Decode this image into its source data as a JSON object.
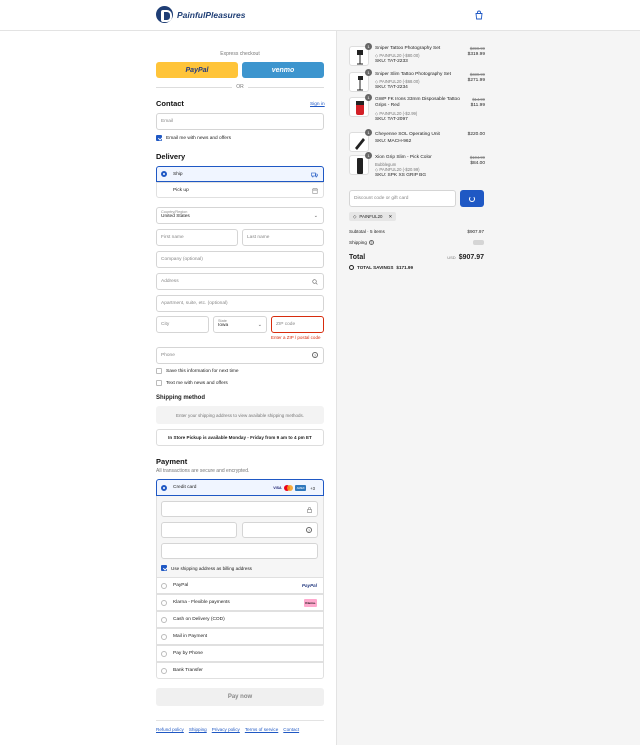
{
  "header": {
    "brand": "PainfulPleasures"
  },
  "express": {
    "title": "Express checkout",
    "paypal": "PayPal",
    "venmo": "venmo",
    "or": "OR"
  },
  "contact": {
    "title": "Contact",
    "signin": "Sign in",
    "email_placeholder": "Email",
    "email_news": "Email me with news and offers"
  },
  "delivery": {
    "title": "Delivery",
    "ship": "Ship",
    "pickup": "Pick up",
    "country_label": "Country/Region",
    "country_value": "United States",
    "first_name": "First name",
    "last_name": "Last name",
    "company": "Company (optional)",
    "address": "Address",
    "apartment": "Apartment, suite, etc. (optional)",
    "city": "City",
    "state_label": "State",
    "state_value": "Iowa",
    "zip": "ZIP code",
    "zip_error": "Enter a ZIP / postal code",
    "phone": "Phone",
    "save_info": "Save this information for next time",
    "text_news": "Text me with news and offers"
  },
  "shipping_method": {
    "title": "Shipping method",
    "placeholder": "Enter your shipping address to view available shipping methods.",
    "pickup_notice": "In Store Pickup is available Monday - Friday from 9 am to 4 pm ET"
  },
  "payment": {
    "title": "Payment",
    "subtitle": "All transactions are secure and encrypted.",
    "credit_card": "Credit card",
    "card_brands": [
      "VISA",
      "MC",
      "AMEX"
    ],
    "more_cards": "+3",
    "billing_same": "Use shipping address as billing address",
    "options": [
      "PayPal",
      "Klarna - Flexible payments",
      "Cash on Delivery (COD)",
      "Mail in Payment",
      "Pay by Phone",
      "Bank Transfer"
    ],
    "paypal_logo": "PayPal",
    "klarna_logo": "Klarna.",
    "pay_now": "Pay now"
  },
  "footer": {
    "links": [
      "Refund policy",
      "Shipping",
      "Privacy policy",
      "Terms of service",
      "Contact"
    ]
  },
  "cart": {
    "items": [
      {
        "qty": "1",
        "name": "Sniper Tattoo Photography Set",
        "discount": "PAINFUL20 (-$80.00)",
        "sku": "SKU: TAT-2233",
        "original": "$399.99",
        "price": "$319.99"
      },
      {
        "qty": "1",
        "name": "Sniper Slim Tattoo Photography Set",
        "discount": "PAINFUL20 (-$68.00)",
        "sku": "SKU: TAT-2234",
        "original": "$339.99",
        "price": "$271.99"
      },
      {
        "qty": "1",
        "name": "GWP FK Irons 33mm Disposable Tattoo Grips - Red",
        "discount": "PAINFUL20 (-$2.99)",
        "sku": "SKU: TAT-2097",
        "original": "$14.99",
        "price": "$11.99"
      },
      {
        "qty": "1",
        "name": "Cheyenne SOL Operating Unit",
        "discount": "",
        "sku": "SKU: MACH-962",
        "original": "",
        "price": "$220.00"
      },
      {
        "qty": "1",
        "name": "Xion Grip Slim - Pick Color",
        "variant": "Bubblegum",
        "discount": "PAINFUL20 (-$20.99)",
        "sku": "SKU: SPK XS GRIP BG",
        "original": "$104.99",
        "price": "$84.00"
      }
    ],
    "discount_placeholder": "Discount code or gift card",
    "applied_code": "PAINFUL20",
    "subtotal_label": "Subtotal · 5 items",
    "subtotal_value": "$907.97",
    "shipping_label": "Shipping",
    "total_label": "Total",
    "currency": "USD",
    "total_value": "$907.97",
    "savings_label": "TOTAL SAVINGS",
    "savings_value": "$171.99"
  },
  "colors": {
    "brand": "#1f3e75",
    "accent": "#1f58c4",
    "paypal_yellow": "#ffc439",
    "venmo_blue": "#3d95ce",
    "error": "#d72c0d"
  }
}
